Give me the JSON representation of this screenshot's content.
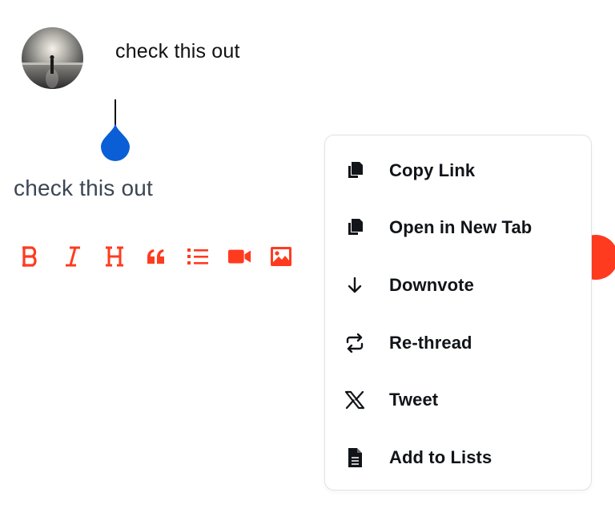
{
  "post": {
    "text": "check this out"
  },
  "editor": {
    "text": "check this out"
  },
  "toolbar": {
    "accent": "#ff3b1f",
    "tools": [
      "bold-icon",
      "italic-icon",
      "heading-icon",
      "quote-icon",
      "list-icon",
      "video-icon",
      "image-icon"
    ]
  },
  "cursor": {
    "color": "#0a5fd6"
  },
  "menu": {
    "items": [
      {
        "label": "Copy Link",
        "icon": "copy-icon"
      },
      {
        "label": "Open in New Tab",
        "icon": "copy-icon"
      },
      {
        "label": "Downvote",
        "icon": "arrow-down-icon"
      },
      {
        "label": "Re-thread",
        "icon": "repost-icon"
      },
      {
        "label": "Tweet",
        "icon": "x-icon"
      },
      {
        "label": "Add to Lists",
        "icon": "document-icon"
      }
    ]
  }
}
